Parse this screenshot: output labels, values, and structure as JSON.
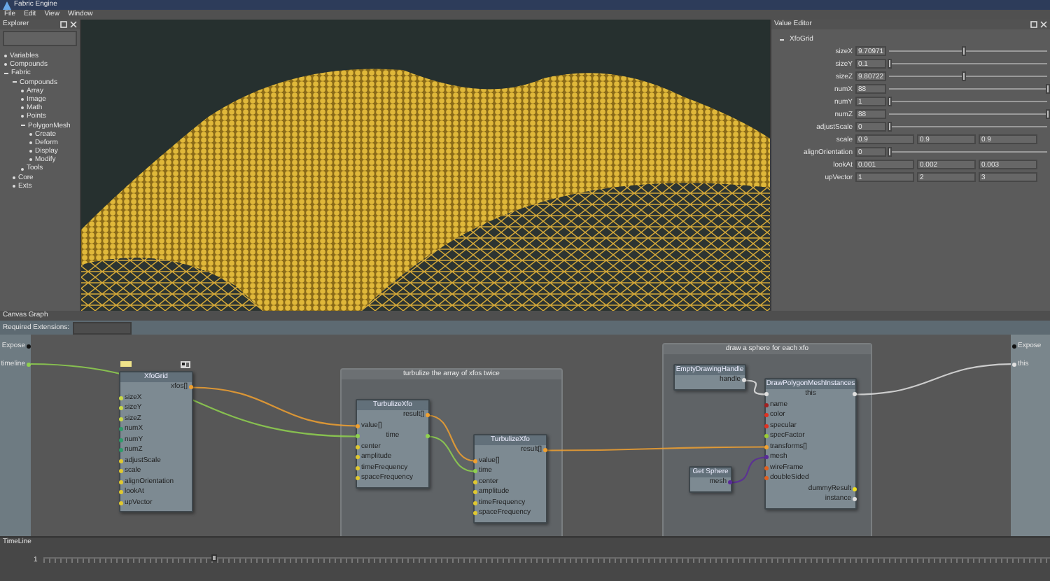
{
  "window": {
    "title": "Fabric Engine"
  },
  "menu": [
    {
      "label": "File"
    },
    {
      "label": "Edit"
    },
    {
      "label": "View"
    },
    {
      "label": "Window"
    }
  ],
  "explorer": {
    "title": "Explorer",
    "tree": [
      {
        "label": "Variables"
      },
      {
        "label": "Compounds"
      },
      {
        "label": "Fabric",
        "expanded": true,
        "children": [
          {
            "label": "Compounds",
            "expanded": true,
            "children": [
              {
                "label": "Array"
              },
              {
                "label": "Image"
              },
              {
                "label": "Math"
              },
              {
                "label": "Points"
              },
              {
                "label": "PolygonMesh",
                "expanded": true,
                "children": [
                  {
                    "label": "Create"
                  },
                  {
                    "label": "Deform"
                  },
                  {
                    "label": "Display"
                  },
                  {
                    "label": "Modify"
                  }
                ]
              },
              {
                "label": "Tools"
              }
            ]
          },
          {
            "label": "Core"
          },
          {
            "label": "Exts"
          }
        ]
      }
    ]
  },
  "value_editor": {
    "title": "Value Editor",
    "section": {
      "label": "XfoGrid",
      "expanded": true
    },
    "rows": [
      {
        "kind": "slider",
        "label": "sizeX",
        "value": "9.70971",
        "level": 0.47
      },
      {
        "kind": "slider",
        "label": "sizeY",
        "value": "0.1",
        "level": 0
      },
      {
        "kind": "slider",
        "label": "sizeZ",
        "value": "9.80722",
        "level": 0.47
      },
      {
        "kind": "slider",
        "label": "numX",
        "value": "88",
        "level": 1
      },
      {
        "kind": "slider",
        "label": "numY",
        "value": "1",
        "level": 0
      },
      {
        "kind": "slider",
        "label": "numZ",
        "value": "88",
        "level": 1
      },
      {
        "kind": "slider",
        "label": "adjustScale",
        "value": "0",
        "level": 0
      },
      {
        "kind": "vector",
        "label": "scale",
        "values": [
          "0.9",
          "0.9",
          "0.9"
        ]
      },
      {
        "kind": "slider",
        "label": "alignOrientation",
        "value": "0",
        "level": 0
      },
      {
        "kind": "vector",
        "label": "lookAt",
        "values": [
          "0.001",
          "0.002",
          "0.003"
        ]
      },
      {
        "kind": "vector",
        "label": "upVector",
        "values": [
          "1",
          "2",
          "3"
        ]
      }
    ]
  },
  "graph": {
    "title": "Canvas Graph",
    "required_extensions_label": "Required Extensions:",
    "left_ports": [
      {
        "label": "Expose",
        "color": "#111111"
      },
      {
        "label": "timeline",
        "color": "#8fd14f"
      }
    ],
    "right_ports": [
      {
        "label": "Expose",
        "color": "#111111"
      },
      {
        "label": "this",
        "color": "#e0e0e0"
      }
    ],
    "backdrops": [
      {
        "title": "turbulize the array of xfos twice"
      },
      {
        "title": "draw a sphere for each xfo"
      }
    ],
    "nodes": [
      {
        "title": "XfoGrid",
        "tagged": true,
        "ports": [
          {
            "kind": "output",
            "label": "xfos[]",
            "color": "#f0a030"
          },
          {
            "kind": "input",
            "label": "sizeX",
            "color": "#c8d848"
          },
          {
            "kind": "input",
            "label": "sizeY",
            "color": "#c8d848"
          },
          {
            "kind": "input",
            "label": "sizeZ",
            "color": "#c8d848"
          },
          {
            "kind": "input",
            "label": "numX",
            "color": "#2f9a6a"
          },
          {
            "kind": "input",
            "label": "numY",
            "color": "#2f9a6a"
          },
          {
            "kind": "input",
            "label": "numZ",
            "color": "#2f9a6a"
          },
          {
            "kind": "input",
            "label": "adjustScale",
            "color": "#e0c830"
          },
          {
            "kind": "input",
            "label": "scale",
            "color": "#e0c830"
          },
          {
            "kind": "input",
            "label": "alignOrientation",
            "color": "#e0c830"
          },
          {
            "kind": "input",
            "label": "lookAt",
            "color": "#e0c830"
          },
          {
            "kind": "input",
            "label": "upVector",
            "color": "#e0c830"
          }
        ]
      },
      {
        "title": "TurbulizeXfo",
        "ports": [
          {
            "kind": "output",
            "label": "result[]",
            "color": "#f0a030"
          },
          {
            "kind": "input",
            "label": "value[]",
            "color": "#f0a030"
          },
          {
            "kind": "through",
            "label": "time",
            "color": "#8fd14f"
          },
          {
            "kind": "input",
            "label": "center",
            "color": "#e0c830"
          },
          {
            "kind": "input",
            "label": "amplitude",
            "color": "#e0c830"
          },
          {
            "kind": "input",
            "label": "timeFrequency",
            "color": "#e0c830"
          },
          {
            "kind": "input",
            "label": "spaceFrequency",
            "color": "#e0c830"
          }
        ]
      },
      {
        "title": "TurbulizeXfo",
        "ports": [
          {
            "kind": "output",
            "label": "result[]",
            "color": "#f0a030"
          },
          {
            "kind": "input",
            "label": "value[]",
            "color": "#f0a030"
          },
          {
            "kind": "input",
            "label": "time",
            "color": "#8fd14f"
          },
          {
            "kind": "input",
            "label": "center",
            "color": "#e0c830"
          },
          {
            "kind": "input",
            "label": "amplitude",
            "color": "#e0c830"
          },
          {
            "kind": "input",
            "label": "timeFrequency",
            "color": "#e0c830"
          },
          {
            "kind": "input",
            "label": "spaceFrequency",
            "color": "#e0c830"
          }
        ]
      },
      {
        "title": "EmptyDrawingHandle",
        "ports": [
          {
            "kind": "output",
            "label": "handle",
            "color": "#e0e0e0"
          }
        ]
      },
      {
        "title": "DrawPolygonMeshInstances",
        "ports": [
          {
            "kind": "through",
            "label": "this",
            "color": "#e0e0e0"
          },
          {
            "kind": "input",
            "label": "name",
            "color": "#a02020"
          },
          {
            "kind": "input",
            "label": "color",
            "color": "#e03020"
          },
          {
            "kind": "input",
            "label": "specular",
            "color": "#e03020"
          },
          {
            "kind": "input",
            "label": "specFactor",
            "color": "#9acd32"
          },
          {
            "kind": "input",
            "label": "transforms[]",
            "color": "#f0a030"
          },
          {
            "kind": "input",
            "label": "mesh",
            "color": "#5a2a9a"
          },
          {
            "kind": "input",
            "label": "wireFrame",
            "color": "#e06020"
          },
          {
            "kind": "input",
            "label": "doubleSided",
            "color": "#e06020"
          },
          {
            "kind": "output",
            "label": "dummyResult",
            "color": "#f0e020"
          },
          {
            "kind": "output",
            "label": "instance",
            "color": "#e0e0e0"
          }
        ]
      },
      {
        "title": "Get Sphere",
        "ports": [
          {
            "kind": "output",
            "label": "mesh",
            "color": "#5a2a9a"
          }
        ]
      }
    ]
  },
  "timeline": {
    "title": "TimeLine",
    "value": "1",
    "level": 0.17
  }
}
